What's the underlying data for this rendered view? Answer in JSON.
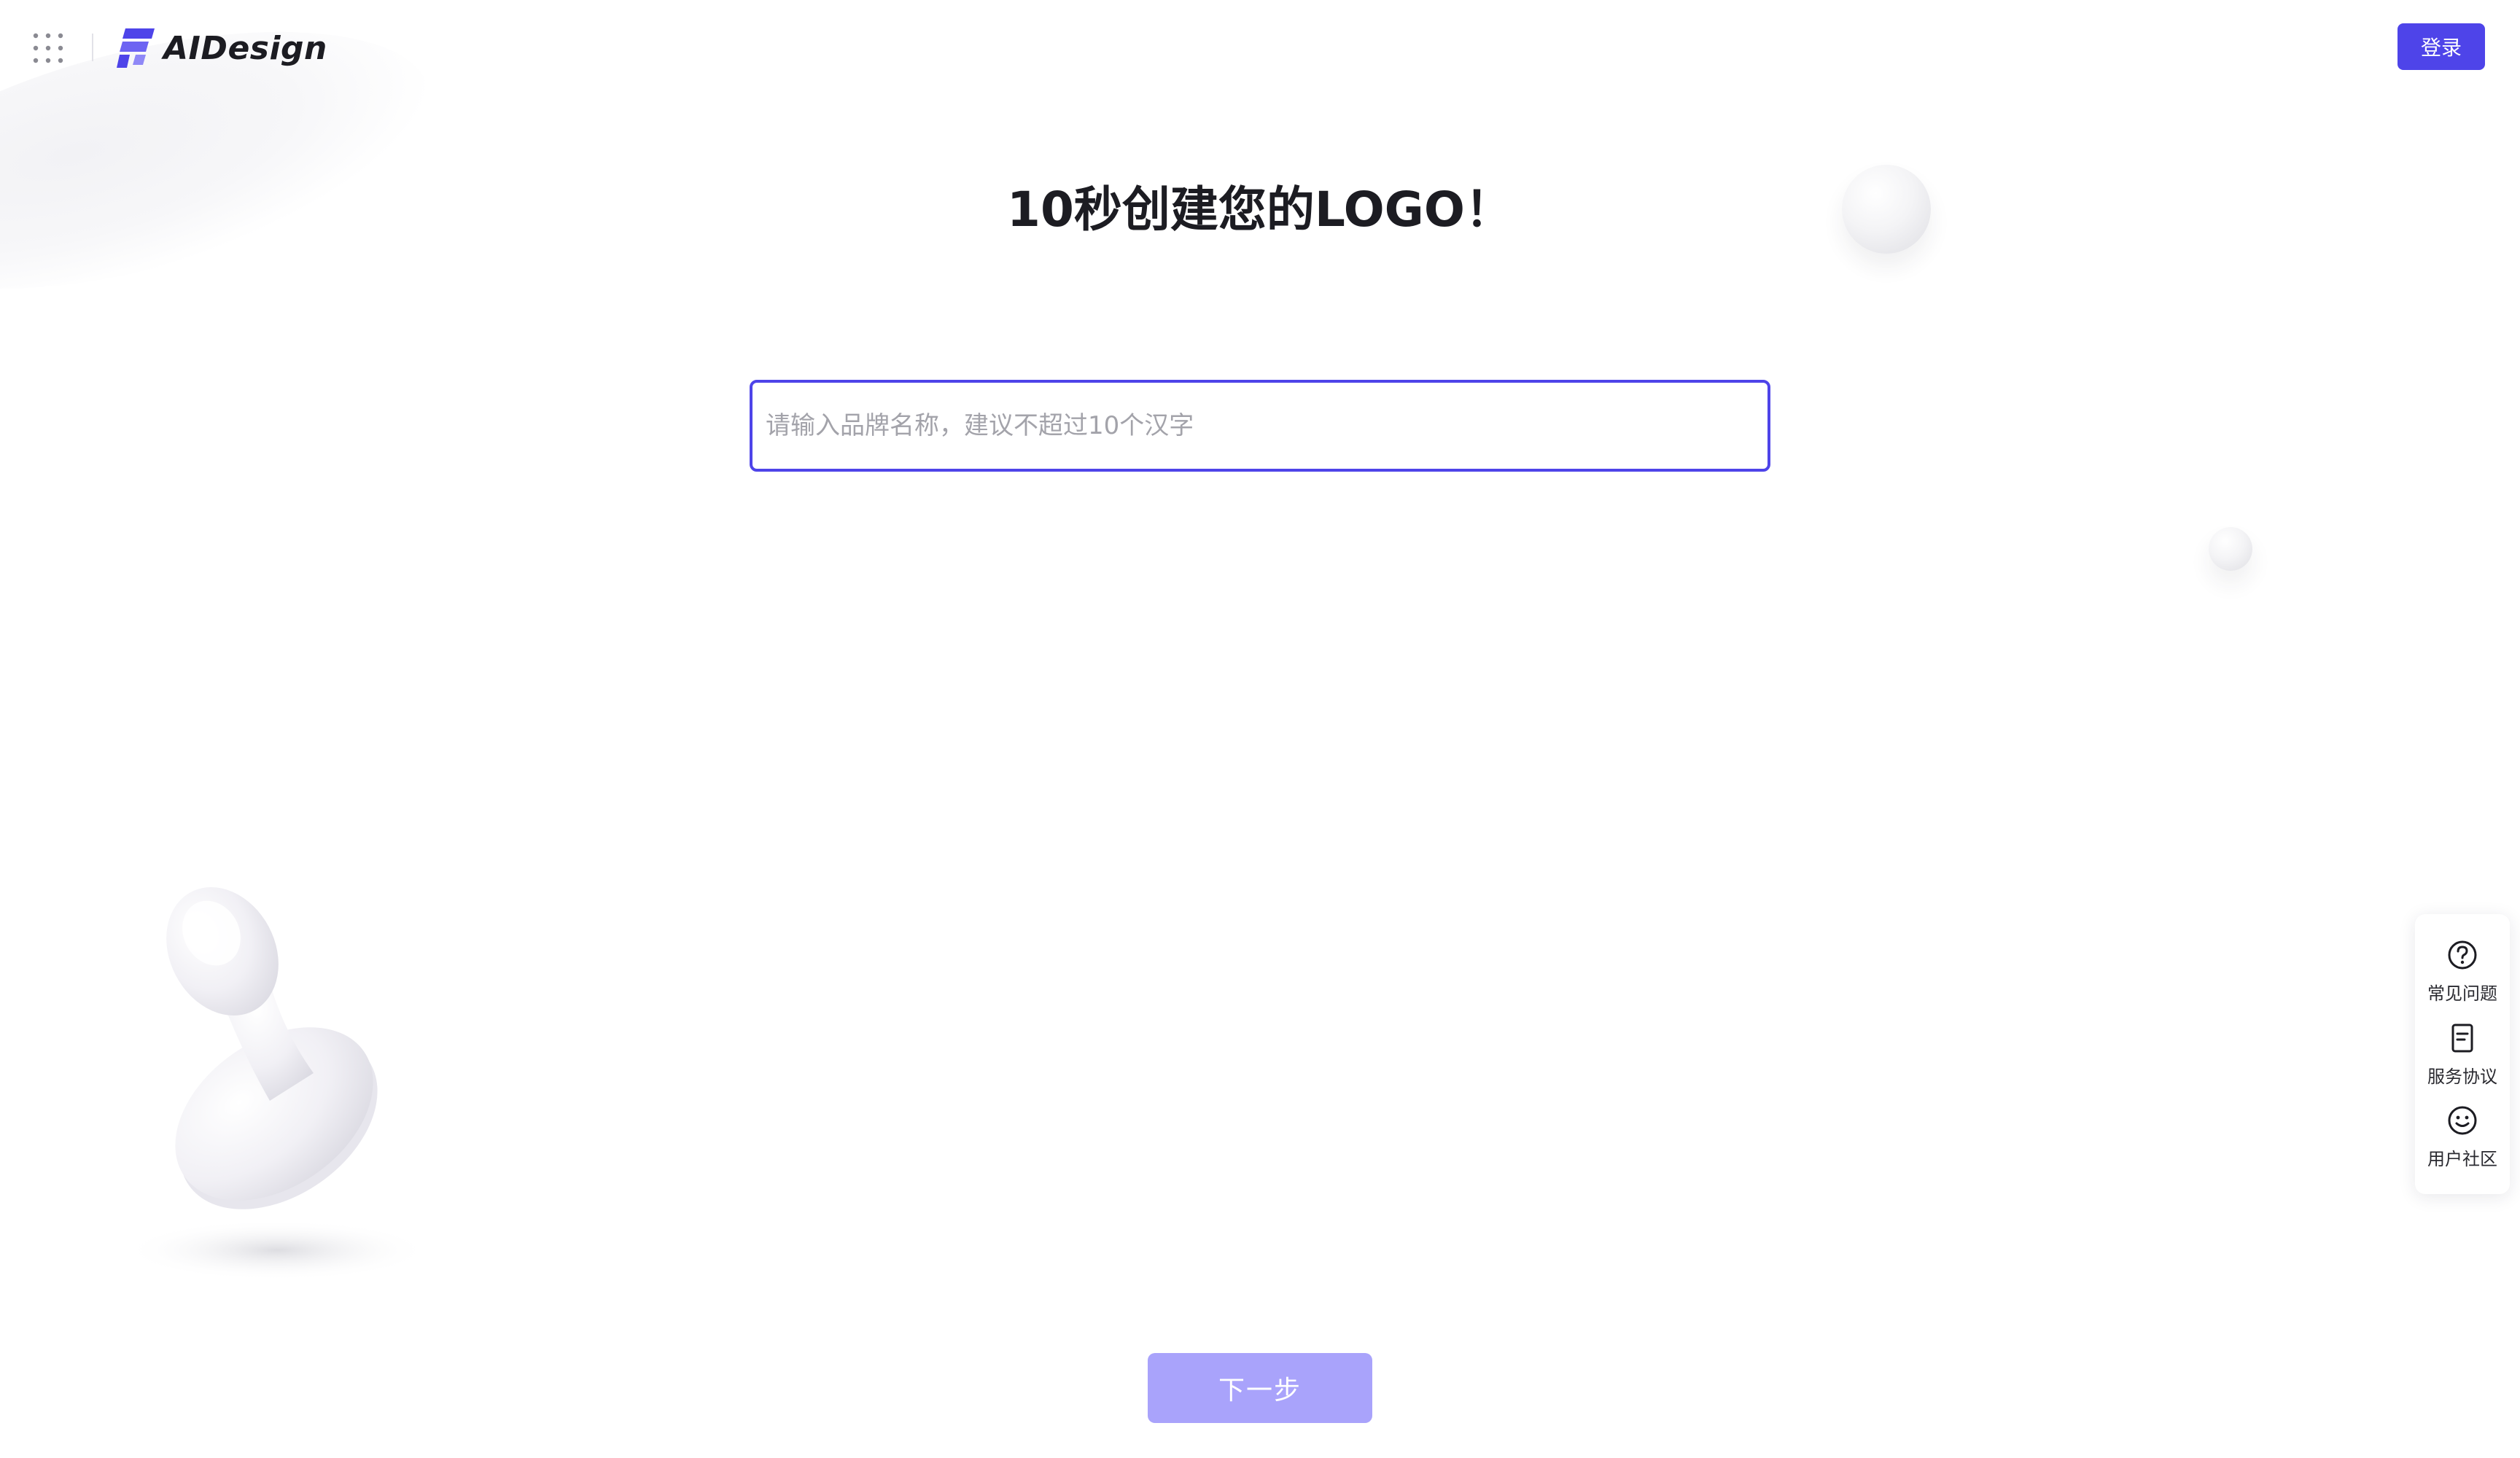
{
  "header": {
    "apps_icon": "apps-grid-icon",
    "brand": {
      "logo_icon": "aidesign-logo-mark",
      "name": "AIDesign"
    },
    "login_label": "登录"
  },
  "main": {
    "title": "10秒创建您的LOGO！",
    "brand_input": {
      "value": "",
      "placeholder": "请输入品牌名称，建议不超过10个汉字"
    },
    "next_label": "下一步"
  },
  "side_panel": {
    "items": [
      {
        "icon": "question-circle-icon",
        "label": "常见问题"
      },
      {
        "icon": "document-icon",
        "label": "服务协议"
      },
      {
        "icon": "smile-icon",
        "label": "用户社区"
      }
    ]
  },
  "colors": {
    "accent": "#4e44e9",
    "accent_disabled": "#a9a3fb",
    "text": "#1c1c22",
    "placeholder": "#a3a3aa"
  }
}
